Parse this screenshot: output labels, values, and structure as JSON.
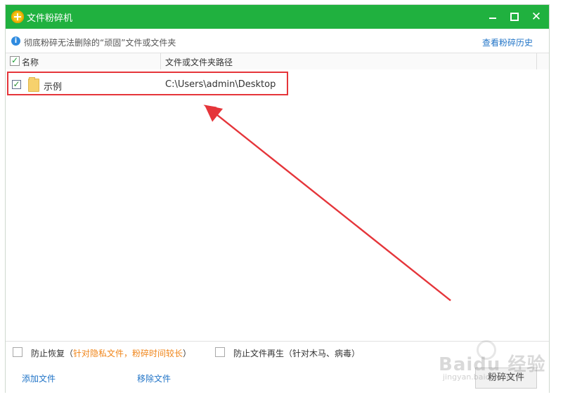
{
  "window": {
    "title": "文件粉碎机"
  },
  "notice": {
    "text": "彻底粉碎无法删除的“顽固”文件或文件夹",
    "history_link": "查看粉碎历史"
  },
  "list": {
    "columns": [
      "名称",
      "文件或文件夹路径"
    ],
    "rows": [
      {
        "name": "示例",
        "path": "C:\\Users\\admin\\Desktop",
        "checked": true
      }
    ]
  },
  "options": {
    "prevent_recovery_label": "防止恢复（",
    "prevent_recovery_hint": "针对隐私文件，粉碎时间较长",
    "prevent_recovery_close": "）",
    "prevent_regen_label": "防止文件再生（针对木马、病毒）"
  },
  "actions": {
    "add_file": "添加文件",
    "remove_file": "移除文件",
    "shred_button": "粉碎文件"
  },
  "watermark": {
    "main": "Baidu 经验",
    "sub": "jingyan.baidu.com"
  },
  "colors": {
    "titlebar": "#20b13f",
    "link": "#2174c7",
    "highlight": "#e5353a",
    "hint": "#f08519"
  }
}
